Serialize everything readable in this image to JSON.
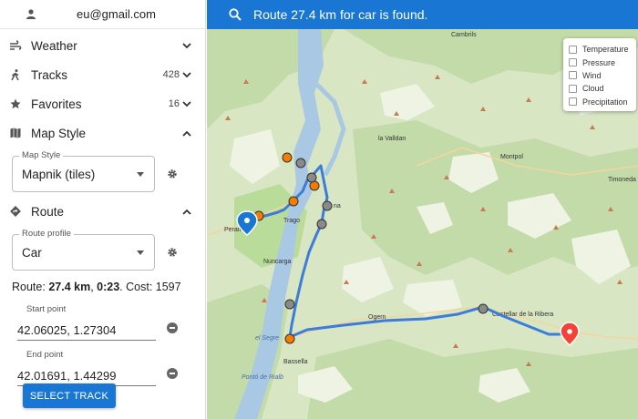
{
  "user": {
    "email": "eu@gmail.com"
  },
  "menu": {
    "weather": {
      "label": "Weather"
    },
    "tracks": {
      "label": "Tracks",
      "count": "428"
    },
    "favorites": {
      "label": "Favorites",
      "count": "16"
    },
    "map_style": {
      "label": "Map Style",
      "select_legend": "Map Style",
      "select_value": "Mapnik (tiles)"
    },
    "route": {
      "label": "Route",
      "profile_legend": "Route profile",
      "profile_value": "Car",
      "summary_prefix": "Route: ",
      "distance": "27.4 km",
      "sep1": ", ",
      "time": "0:23",
      "sep2": ". Cost: ",
      "cost": "1597",
      "start_label": "Start point",
      "start_value": "42.06025, 1.27304",
      "end_label": "End point",
      "end_value": "42.01691, 1.44299",
      "select_track_label": "SELECT TRACK"
    }
  },
  "topbar": {
    "status": "Route 27.4 km for car is found."
  },
  "layers": [
    "Temperature",
    "Pressure",
    "Wind",
    "Cloud",
    "Precipitation"
  ],
  "map_labels": {
    "cambrils": "Cambrils",
    "la_valldan": "la Valldan",
    "montpol": "Montpol",
    "timoneda": "Timonedа",
    "trago": "Trago",
    "peramola": "Peram",
    "na": "na",
    "nuncarga": "Nuncarga",
    "segre": "el Segre",
    "bassella": "Bassella",
    "castellar": "Castellar de la Ribera",
    "rialb": "Pontó de Rialb",
    "ogern": "Ogern"
  },
  "colors": {
    "accent": "#1976d2",
    "route": "#3b7dd8",
    "marker_start": "#1976d2",
    "marker_end": "#f44336",
    "waypoint_orange": "#f57c00",
    "waypoint_gray": "#8a8a8a"
  }
}
